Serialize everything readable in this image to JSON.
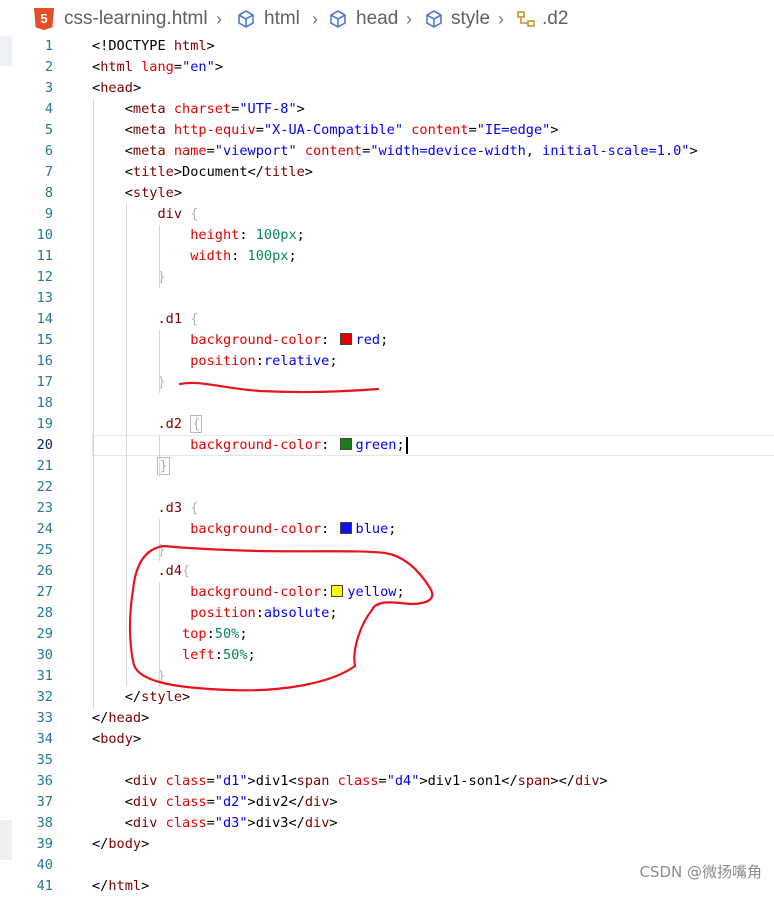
{
  "breadcrumb": {
    "file": "css-learning.html",
    "items": [
      "html",
      "head",
      "style",
      ".d2"
    ],
    "file_icon": "html5-icon",
    "element_icon": "cube-icon",
    "selector_icon": "css-selector-icon"
  },
  "lines": [
    {
      "n": "1",
      "segs": [
        [
          "p",
          "<!DOCTYPE "
        ],
        [
          "t",
          "html"
        ],
        [
          "p",
          ">"
        ]
      ]
    },
    {
      "n": "2",
      "segs": [
        [
          "p",
          "<"
        ],
        [
          "t",
          "html"
        ],
        [
          "p",
          " "
        ],
        [
          "a",
          "lang"
        ],
        [
          "p",
          "="
        ],
        [
          "s",
          "\"en\""
        ],
        [
          "p",
          ">"
        ]
      ]
    },
    {
      "n": "3",
      "segs": [
        [
          "p",
          "<"
        ],
        [
          "t",
          "head"
        ],
        [
          "p",
          ">"
        ]
      ]
    },
    {
      "n": "4",
      "segs": [
        [
          "p",
          "    <"
        ],
        [
          "t",
          "meta"
        ],
        [
          "p",
          " "
        ],
        [
          "a",
          "charset"
        ],
        [
          "p",
          "="
        ],
        [
          "s",
          "\"UTF-8\""
        ],
        [
          "p",
          ">"
        ]
      ]
    },
    {
      "n": "5",
      "segs": [
        [
          "p",
          "    <"
        ],
        [
          "t",
          "meta"
        ],
        [
          "p",
          " "
        ],
        [
          "a",
          "http-equiv"
        ],
        [
          "p",
          "="
        ],
        [
          "s",
          "\"X-UA-Compatible\""
        ],
        [
          "p",
          " "
        ],
        [
          "a",
          "content"
        ],
        [
          "p",
          "="
        ],
        [
          "s",
          "\"IE=edge\""
        ],
        [
          "p",
          ">"
        ]
      ]
    },
    {
      "n": "6",
      "segs": [
        [
          "p",
          "    <"
        ],
        [
          "t",
          "meta"
        ],
        [
          "p",
          " "
        ],
        [
          "a",
          "name"
        ],
        [
          "p",
          "="
        ],
        [
          "s",
          "\"viewport\""
        ],
        [
          "p",
          " "
        ],
        [
          "a",
          "content"
        ],
        [
          "p",
          "="
        ],
        [
          "s",
          "\"width=device-width, initial-scale=1.0\""
        ],
        [
          "p",
          ">"
        ]
      ]
    },
    {
      "n": "7",
      "segs": [
        [
          "p",
          "    <"
        ],
        [
          "t",
          "title"
        ],
        [
          "p",
          ">Document</"
        ],
        [
          "t",
          "title"
        ],
        [
          "p",
          ">"
        ]
      ]
    },
    {
      "n": "8",
      "segs": [
        [
          "p",
          "    <"
        ],
        [
          "t",
          "style"
        ],
        [
          "p",
          ">"
        ]
      ]
    },
    {
      "n": "9",
      "segs": [
        [
          "p",
          "        "
        ],
        [
          "t",
          "div"
        ],
        [
          "p",
          " "
        ],
        [
          "b",
          "{"
        ]
      ]
    },
    {
      "n": "10",
      "segs": [
        [
          "p",
          "            "
        ],
        [
          "a",
          "height"
        ],
        [
          "p",
          ": "
        ],
        [
          "n",
          "100px"
        ],
        [
          "p",
          ";"
        ]
      ]
    },
    {
      "n": "11",
      "segs": [
        [
          "p",
          "            "
        ],
        [
          "a",
          "width"
        ],
        [
          "p",
          ": "
        ],
        [
          "n",
          "100px"
        ],
        [
          "p",
          ";"
        ]
      ]
    },
    {
      "n": "12",
      "segs": [
        [
          "p",
          "        "
        ],
        [
          "b",
          "}"
        ]
      ]
    },
    {
      "n": "13",
      "segs": []
    },
    {
      "n": "14",
      "segs": [
        [
          "p",
          "        "
        ],
        [
          "t",
          ".d1"
        ],
        [
          "p",
          " "
        ],
        [
          "b",
          "{"
        ]
      ]
    },
    {
      "n": "15",
      "segs": [
        [
          "p",
          "            "
        ],
        [
          "a",
          "background-color"
        ],
        [
          "p",
          ": "
        ],
        [
          "sw",
          "#e00000"
        ],
        [
          "s",
          "red"
        ],
        [
          "p",
          ";"
        ]
      ]
    },
    {
      "n": "16",
      "segs": [
        [
          "p",
          "            "
        ],
        [
          "a",
          "position"
        ],
        [
          "p",
          ":"
        ],
        [
          "s",
          "relative"
        ],
        [
          "p",
          ";"
        ]
      ]
    },
    {
      "n": "17",
      "segs": [
        [
          "p",
          "        "
        ],
        [
          "b",
          "}"
        ]
      ]
    },
    {
      "n": "18",
      "segs": []
    },
    {
      "n": "19",
      "segs": [
        [
          "p",
          "        "
        ],
        [
          "t",
          ".d2"
        ],
        [
          "p",
          " "
        ],
        [
          "bx",
          "{"
        ]
      ]
    },
    {
      "n": "20",
      "segs": [
        [
          "p",
          "            "
        ],
        [
          "a",
          "background-color"
        ],
        [
          "p",
          ": "
        ],
        [
          "sw",
          "#1a7f1a"
        ],
        [
          "s",
          "green"
        ],
        [
          "p",
          ";"
        ],
        [
          "cur",
          ""
        ]
      ]
    },
    {
      "n": "21",
      "segs": [
        [
          "p",
          "        "
        ],
        [
          "bx",
          "}"
        ]
      ]
    },
    {
      "n": "22",
      "segs": []
    },
    {
      "n": "23",
      "segs": [
        [
          "p",
          "        "
        ],
        [
          "t",
          ".d3"
        ],
        [
          "p",
          " "
        ],
        [
          "b",
          "{"
        ]
      ]
    },
    {
      "n": "24",
      "segs": [
        [
          "p",
          "            "
        ],
        [
          "a",
          "background-color"
        ],
        [
          "p",
          ": "
        ],
        [
          "sw",
          "#1010ee"
        ],
        [
          "s",
          "blue"
        ],
        [
          "p",
          ";"
        ]
      ]
    },
    {
      "n": "25",
      "segs": [
        [
          "p",
          "        "
        ],
        [
          "b",
          "}"
        ]
      ]
    },
    {
      "n": "26",
      "segs": [
        [
          "p",
          "        "
        ],
        [
          "t",
          ".d4"
        ],
        [
          "b",
          "{"
        ]
      ]
    },
    {
      "n": "27",
      "segs": [
        [
          "p",
          "            "
        ],
        [
          "a",
          "background-color"
        ],
        [
          "p",
          ":"
        ],
        [
          "sw",
          "#ffff00"
        ],
        [
          "s",
          "yellow"
        ],
        [
          "p",
          ";"
        ]
      ]
    },
    {
      "n": "28",
      "segs": [
        [
          "p",
          "            "
        ],
        [
          "a",
          "position"
        ],
        [
          "p",
          ":"
        ],
        [
          "s",
          "absolute"
        ],
        [
          "p",
          ";"
        ]
      ]
    },
    {
      "n": "29",
      "segs": [
        [
          "p",
          "           "
        ],
        [
          "a",
          "top"
        ],
        [
          "p",
          ":"
        ],
        [
          "n",
          "50%"
        ],
        [
          "p",
          ";"
        ]
      ]
    },
    {
      "n": "30",
      "segs": [
        [
          "p",
          "           "
        ],
        [
          "a",
          "left"
        ],
        [
          "p",
          ":"
        ],
        [
          "n",
          "50%"
        ],
        [
          "p",
          ";"
        ]
      ]
    },
    {
      "n": "31",
      "segs": [
        [
          "p",
          "        "
        ],
        [
          "b",
          "}"
        ]
      ]
    },
    {
      "n": "32",
      "segs": [
        [
          "p",
          "    </"
        ],
        [
          "t",
          "style"
        ],
        [
          "p",
          ">"
        ]
      ]
    },
    {
      "n": "33",
      "segs": [
        [
          "p",
          "</"
        ],
        [
          "t",
          "head"
        ],
        [
          "p",
          ">"
        ]
      ]
    },
    {
      "n": "34",
      "segs": [
        [
          "p",
          "<"
        ],
        [
          "t",
          "body"
        ],
        [
          "p",
          ">"
        ]
      ]
    },
    {
      "n": "35",
      "segs": []
    },
    {
      "n": "36",
      "segs": [
        [
          "p",
          "    <"
        ],
        [
          "t",
          "div"
        ],
        [
          "p",
          " "
        ],
        [
          "a",
          "class"
        ],
        [
          "p",
          "="
        ],
        [
          "s",
          "\"d1\""
        ],
        [
          "p",
          ">div1<"
        ],
        [
          "t",
          "span"
        ],
        [
          "p",
          " "
        ],
        [
          "a",
          "class"
        ],
        [
          "p",
          "="
        ],
        [
          "s",
          "\"d4\""
        ],
        [
          "p",
          ">div1-son1</"
        ],
        [
          "t",
          "span"
        ],
        [
          "p",
          "></"
        ],
        [
          "t",
          "div"
        ],
        [
          "p",
          ">"
        ]
      ]
    },
    {
      "n": "37",
      "segs": [
        [
          "p",
          "    <"
        ],
        [
          "t",
          "div"
        ],
        [
          "p",
          " "
        ],
        [
          "a",
          "class"
        ],
        [
          "p",
          "="
        ],
        [
          "s",
          "\"d2\""
        ],
        [
          "p",
          ">div2</"
        ],
        [
          "t",
          "div"
        ],
        [
          "p",
          ">"
        ]
      ]
    },
    {
      "n": "38",
      "segs": [
        [
          "p",
          "    <"
        ],
        [
          "t",
          "div"
        ],
        [
          "p",
          " "
        ],
        [
          "a",
          "class"
        ],
        [
          "p",
          "="
        ],
        [
          "s",
          "\"d3\""
        ],
        [
          "p",
          ">div3</"
        ],
        [
          "t",
          "div"
        ],
        [
          "p",
          ">"
        ]
      ]
    },
    {
      "n": "39",
      "segs": [
        [
          "p",
          "</"
        ],
        [
          "t",
          "body"
        ],
        [
          "p",
          ">"
        ]
      ]
    },
    {
      "n": "40",
      "segs": []
    },
    {
      "n": "41",
      "segs": [
        [
          "p",
          "</"
        ],
        [
          "t",
          "html"
        ],
        [
          "p",
          ">"
        ]
      ]
    }
  ],
  "active_line": "20",
  "annotation_color": "#e8131f",
  "watermark": "CSDN @微扬嘴角"
}
